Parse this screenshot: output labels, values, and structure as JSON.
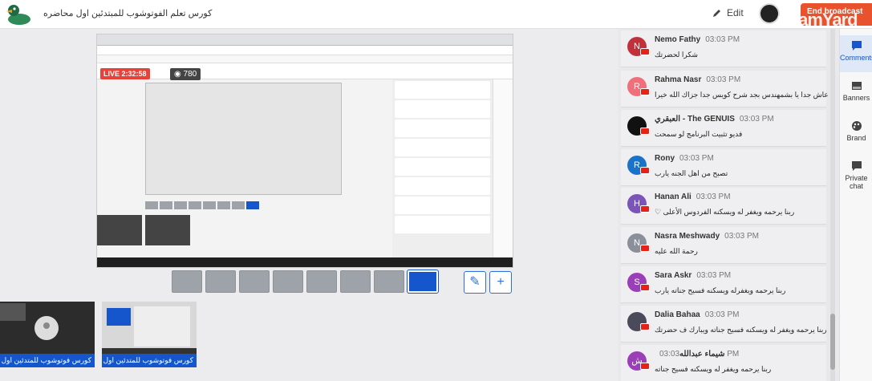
{
  "header": {
    "title": "كورس تعلم الفوتوشوب للمبتدئين اول محاضره",
    "edit_label": "Edit",
    "end_label": "End broadcast",
    "watermark": "treamYard"
  },
  "stream": {
    "live_label": "LIVE 2:32:58",
    "viewers": "780"
  },
  "layouts": [
    "solo",
    "group-2",
    "group-3",
    "group-4",
    "presenter",
    "thumbs",
    "screen-1",
    "screen-full"
  ],
  "cameras": [
    {
      "label": "كورس فوتوشوب للمتدئين اول محاضره"
    },
    {
      "label": "كورس فوتوشوب للمتدئين اول محاضره"
    }
  ],
  "chat": {
    "messages": [
      {
        "name": "Nemo Fathy",
        "time": "03:03 PM",
        "text": "شكرا لحضرتك",
        "initial": "N",
        "color": "#c0313b"
      },
      {
        "name": "Rahma Nasr",
        "time": "03:03 PM",
        "text": "عاش جدا يا بشمهندس بجد شرح كويس جدا جزاك الله خيرا",
        "initial": "R",
        "color": "#ef6f7b"
      },
      {
        "name": "العبقري - The GENUIS",
        "time": "03:03 PM",
        "text": "فديو تثبيت البرنامج لو سمحت",
        "initial": "",
        "color": "#111111"
      },
      {
        "name": "Rony",
        "time": "03:03 PM",
        "text": "تصبح من اهل الجنه يارب",
        "initial": "R",
        "color": "#1a73c9"
      },
      {
        "name": "Hanan Ali",
        "time": "03:03 PM",
        "text": "ربنا يرحمه ويغفر له ويسكنه الفردوس الأعلى ♡",
        "initial": "H",
        "color": "#7a54b8"
      },
      {
        "name": "Nasra Meshwady",
        "time": "03:03 PM",
        "text": "رحمة الله عليه",
        "initial": "N",
        "color": "#8a8f99"
      },
      {
        "name": "Sara Askr",
        "time": "03:03 PM",
        "text": "ربنا يرحمه ويغفرله ويسكنه فسيح جناته يارب",
        "initial": "S",
        "color": "#9b3fb8"
      },
      {
        "name": "Dalia Bahaa",
        "time": "03:03 PM",
        "text": "ربنا يرحمه ويغفر له ويسكنه فسيح جناته ويبارك ف حضرتك",
        "initial": "",
        "color": "#4a4a5a"
      },
      {
        "name": "شيماء عبدالله",
        "time": "03:03 PM",
        "text": "ربنا يرحمه ويغفر له ويسكنه فسيح جناته",
        "initial": "ش",
        "color": "#9b3fb8"
      }
    ]
  },
  "sidebar": {
    "items": [
      {
        "label": "Comments",
        "icon": "comment-icon"
      },
      {
        "label": "Banners",
        "icon": "banner-icon"
      },
      {
        "label": "Brand",
        "icon": "palette-icon"
      },
      {
        "label": "Private chat",
        "icon": "private-chat-icon"
      }
    ]
  }
}
